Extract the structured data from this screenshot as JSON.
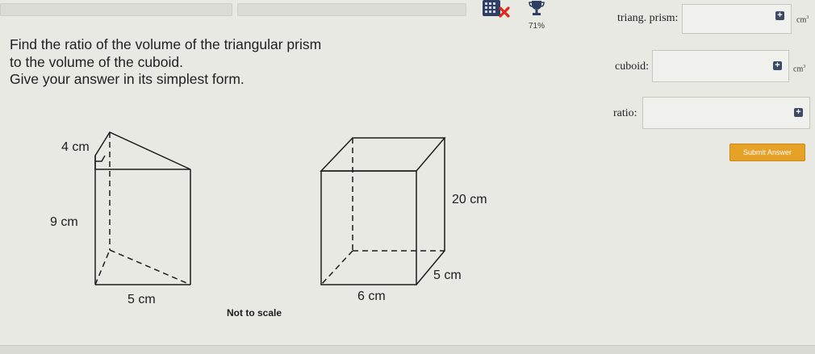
{
  "header": {
    "progress_percent": "71%"
  },
  "question": {
    "lines": [
      "Find the ratio of the volume of the triangular prism",
      "to the volume of the cuboid.",
      "Give your answer in its simplest form."
    ]
  },
  "answers": {
    "prism_label": "triang. prism:",
    "cuboid_label": "cuboid:",
    "ratio_label": "ratio:",
    "unit_base": "cm",
    "unit_exp": "3",
    "prism_value": "",
    "cuboid_value": "",
    "ratio_value": "",
    "submit_label": "Submit Answer"
  },
  "prism": {
    "top_dim": "4 cm",
    "height_dim": "9 cm",
    "base_dim": "5 cm"
  },
  "cuboid": {
    "height_dim": "20 cm",
    "depth_dim": "5 cm",
    "width_dim": "6 cm"
  },
  "note": "Not to scale",
  "colors": {
    "submit": "#e6a127",
    "plus": "#3b4a66",
    "background": "#e9e9e4"
  },
  "icons": [
    "grid-icon",
    "cross-icon",
    "trophy-icon",
    "plus-icon"
  ]
}
